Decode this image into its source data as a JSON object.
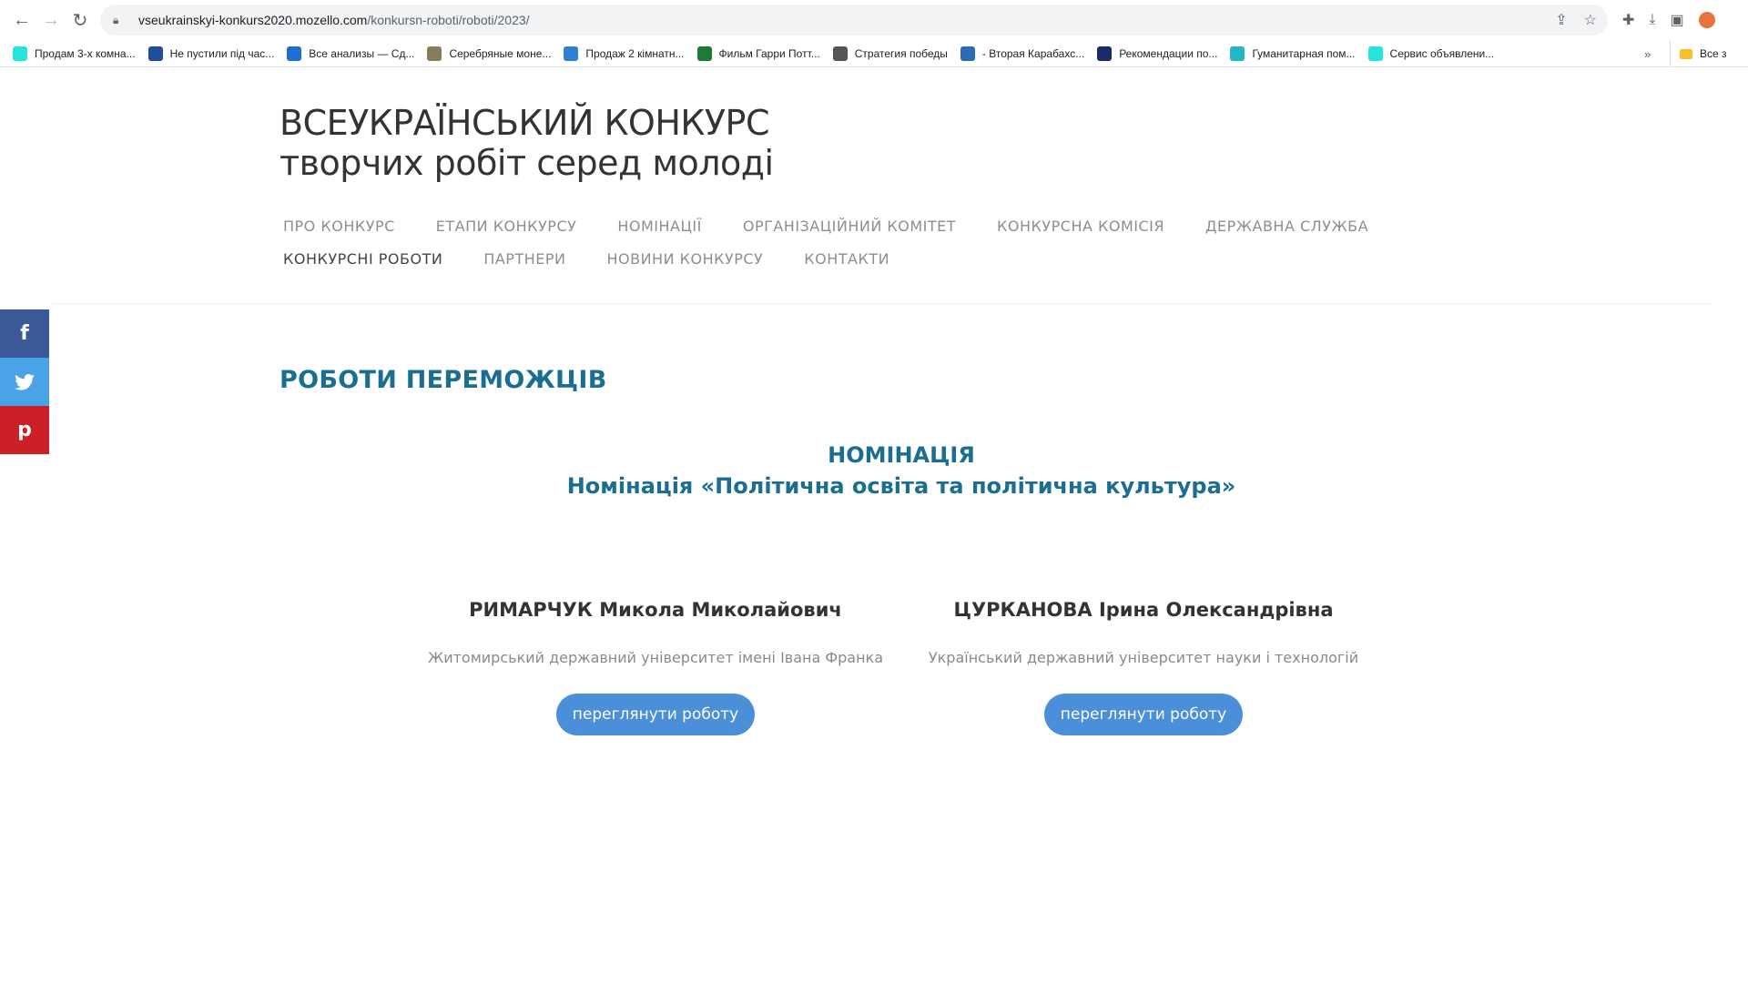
{
  "browser": {
    "url_host": "vseukrainskyi-konkurs2020.mozello.com",
    "url_path": "/konkursn-roboti/roboti/2023/",
    "bookmarks": [
      {
        "label": "Продам 3-х комна...",
        "icon": "olx-icon",
        "color": "#23e5db"
      },
      {
        "label": "Не пустили під час...",
        "icon": "flag-icon",
        "color": "#1f4e9c"
      },
      {
        "label": "Все анализы — Сд...",
        "icon": "flower-icon",
        "color": "#1b6fd6"
      },
      {
        "label": "Серебряные моне...",
        "icon": "coin-icon",
        "color": "#8a7b5a"
      },
      {
        "label": "Продаж 2 кімнатн...",
        "icon": "home-icon",
        "color": "#2f7fd3"
      },
      {
        "label": "Фильм Гарри Потт...",
        "icon": "film-icon",
        "color": "#1e7a34"
      },
      {
        "label": "Стратегия победы",
        "icon": "strategy-icon",
        "color": "#555555"
      },
      {
        "label": "- Вторая Карабахс...",
        "icon": "news-icon",
        "color": "#2a6db5"
      },
      {
        "label": "Рекомендации по...",
        "icon": "doc-icon",
        "color": "#1a2b6b"
      },
      {
        "label": "Гуманитарная пом...",
        "icon": "help-icon",
        "color": "#21b6c9"
      },
      {
        "label": "Сервис объявлени...",
        "icon": "olx-icon",
        "color": "#23e5db"
      }
    ],
    "more_label": "»",
    "all_bookmarks_label": "Все з"
  },
  "site": {
    "title_line1": "ВСЕУКРАЇНСЬКИЙ КОНКУРС",
    "title_line2": "творчих робіт серед молоді"
  },
  "menu": {
    "row1": [
      "ПРО КОНКУРС",
      "ЕТАПИ КОНКУРСУ",
      "НОМІНАЦІЇ",
      "ОРГАНІЗАЦІЙНИЙ КОМІТЕТ",
      "КОНКУРСНА КОМІСІЯ",
      "ДЕРЖАВНА СЛУЖБА"
    ],
    "row2": [
      "КОНКУРСНІ РОБОТИ",
      "ПАРТНЕРИ",
      "НОВИНИ КОНКУРСУ",
      "КОНТАКТИ"
    ],
    "active": "КОНКУРСНІ РОБОТИ"
  },
  "social": {
    "facebook": "f",
    "twitter": "t",
    "pinterest": "p"
  },
  "content": {
    "heading": "РОБОТИ ПЕРЕМОЖЦІВ",
    "nomination_label": "НОМІНАЦІЯ",
    "nomination_name": "Номінація «Політична освіта та політична культура»",
    "winners": [
      {
        "name": "РИМАРЧУК Микола Миколайович",
        "university": "Житомирський державний університет імені Івана Франка",
        "button": "переглянути роботу"
      },
      {
        "name": "ЦУРКАНОВА Ірина Олександрівна",
        "university": "Український державний університет науки і технологій",
        "button": "переглянути роботу"
      }
    ]
  }
}
